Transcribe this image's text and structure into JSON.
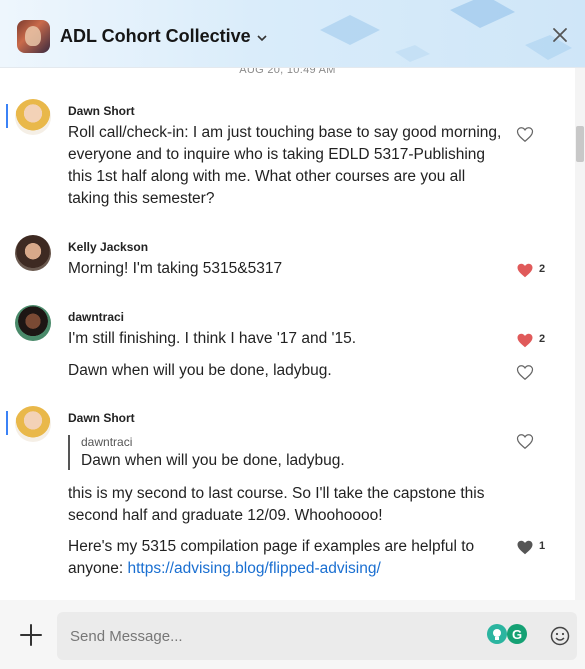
{
  "header": {
    "title": "ADL Cohort Collective",
    "chevron_icon": "chevron-down-icon",
    "close_icon": "close-icon"
  },
  "timestamp": "AUG 20, 10:49 AM",
  "messages": [
    {
      "author": "Dawn Short",
      "text": "Roll call/check-in: I am just touching base to say good morning, everyone and to inquire who is taking EDLD 5317-Publishing this 1st half along with me. What other courses are you all taking this semester?",
      "reaction": {
        "icon": "heart-outline-icon"
      }
    },
    {
      "author": "Kelly Jackson",
      "text": "Morning! I'm taking 5315&5317",
      "reaction": {
        "icon": "heart-filled-icon",
        "count": "2"
      }
    },
    {
      "author": "dawntraci",
      "text": "I'm still finishing. I think I have '17 and '15.",
      "reaction": {
        "icon": "heart-filled-icon",
        "count": "2"
      },
      "followup": {
        "text": "Dawn when will you be done, ladybug.",
        "reaction": {
          "icon": "heart-outline-icon"
        }
      }
    },
    {
      "author": "Dawn Short",
      "quote": {
        "author": "dawntraci",
        "text": "Dawn when will you be done, ladybug."
      },
      "text": "this is my second to last course. So I'll take the capstone this second half and graduate 12/09. Whoohoooo!",
      "reaction": {
        "icon": "heart-outline-icon"
      },
      "followup": {
        "text": "Here's my 5315 compilation page if examples are helpful to anyone: ",
        "link": "https://advising.blog/flipped-advising/",
        "reaction": {
          "icon": "heart-dark-icon",
          "count": "1"
        }
      }
    }
  ],
  "composer": {
    "placeholder": "Send Message...",
    "plus_icon": "plus-icon",
    "emoji_icon": "smiley-icon"
  },
  "colors": {
    "accent_blue": "#3b82f6",
    "heart_red": "#e05a5a",
    "link_blue": "#1a6fd1"
  }
}
